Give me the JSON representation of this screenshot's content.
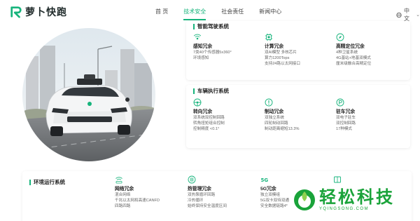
{
  "brand": {
    "name": "萝卜快跑"
  },
  "nav": {
    "items": [
      "首 页",
      "技术安全",
      "社会责任",
      "新闻中心"
    ],
    "active_index": 1
  },
  "language": {
    "label": "中文"
  },
  "accent_color": "#17b47c",
  "sections": {
    "autonomous": {
      "title": "智能驾驶系统",
      "features": [
        {
          "icon": "sensor-icon",
          "title": "感知冗余",
          "lines": [
            "7类40个传感器5x360°",
            "环境感知"
          ]
        },
        {
          "icon": "chip-icon",
          "title": "计算冗余",
          "lines": [
            "双AI模型 多核芯片",
            "算力1200Tops",
            "支持24路以太网接口"
          ]
        },
        {
          "icon": "compass-icon",
          "title": "高精定位冗余",
          "lines": [
            "4种卫星系统",
            "4G基站+地基双模式",
            "厘米级融合高精定位"
          ]
        }
      ]
    },
    "vehicle": {
      "title": "车辆执行系统",
      "features": [
        {
          "icon": "steering-icon",
          "title": "转向冗余",
          "lines": [
            "双系统双控制回路",
            "转角扭矩组合控制",
            "控制精度 <0.1°"
          ]
        },
        {
          "icon": "brake-icon",
          "title": "制动冗余",
          "lines": [
            "双独立系统",
            "四轮制动回路",
            "制动距离缩短13.3%"
          ]
        },
        {
          "icon": "parking-icon",
          "title": "驻车冗余",
          "lines": [
            "双电子驻车",
            "双控制回路",
            "17种模式"
          ]
        }
      ]
    },
    "environment": {
      "title": "环境运行系统",
      "features": [
        {
          "icon": "network-icon",
          "title": "网络冗余",
          "lines": [
            "混合网络",
            "千兆以太网和高速CANFD",
            "四路四路"
          ]
        },
        {
          "icon": "thermal-icon",
          "title": "热管理冗余",
          "lines": [
            "双热泵循环回路",
            "冷热循环",
            "始终保持安全温度区间"
          ]
        },
        {
          "icon": "5g-icon",
          "title": "5G冗余",
          "lines": [
            "独立双模组",
            "5G双卡双待双通",
            "安全数据链路4*"
          ]
        },
        {
          "icon": "book-icon",
          "title": "",
          "lines": []
        }
      ]
    }
  },
  "watermark": {
    "name": "轻松科技",
    "url": "YQINGSONG.COM"
  }
}
